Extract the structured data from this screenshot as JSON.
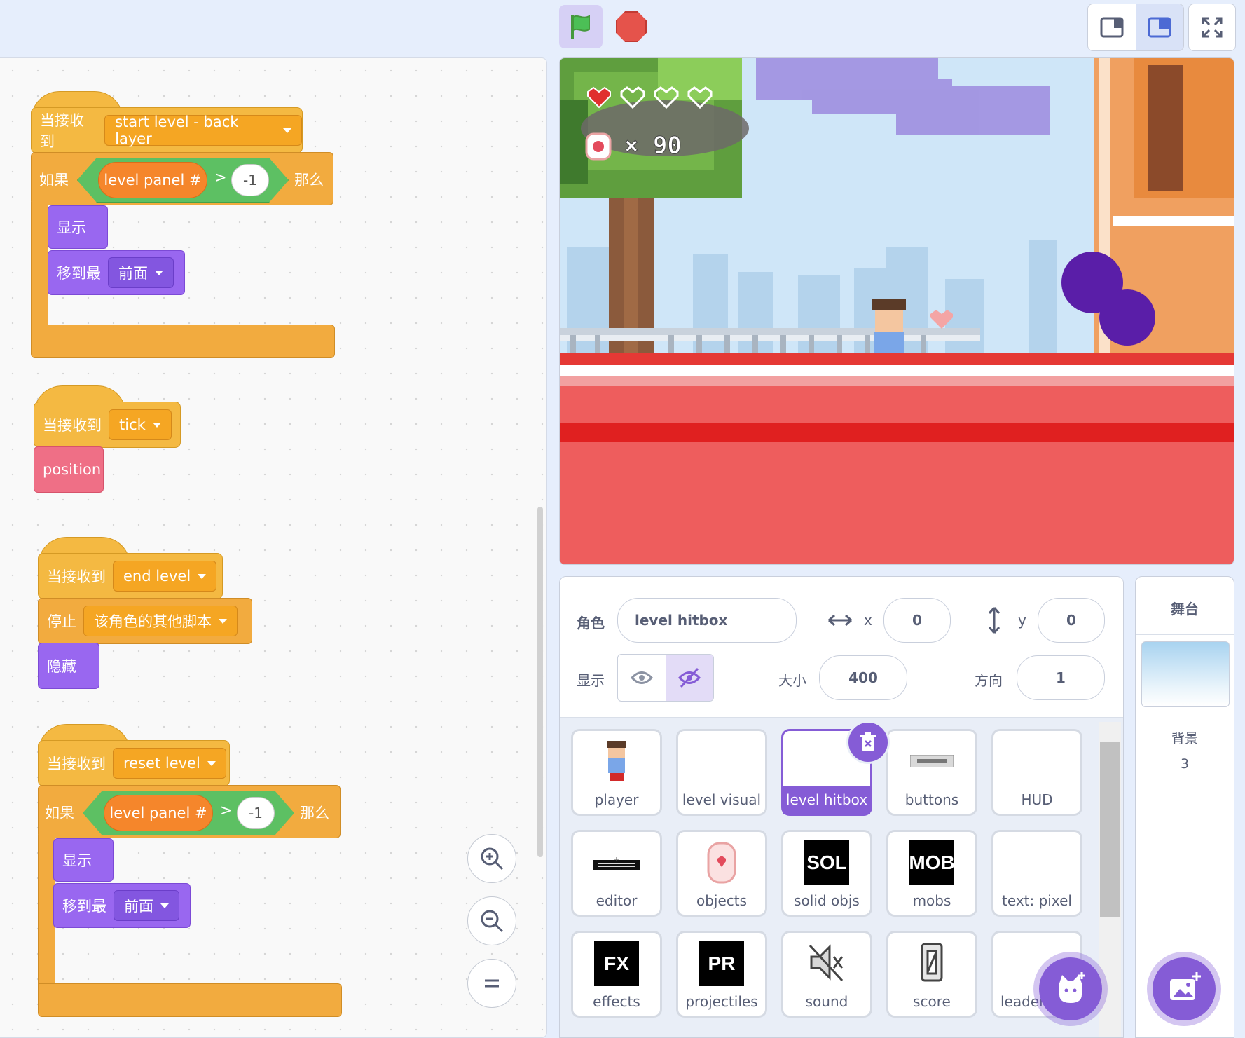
{
  "colors": {
    "events": "#f4b942",
    "control": "#f2ab3f",
    "looks": "#9967f0",
    "operators": "#5dc063",
    "variables": "#f5862b",
    "my_blocks": "#ef6f86",
    "accent": "#855cd6"
  },
  "scripts": [
    {
      "hat": {
        "label": "当接收到",
        "message": "start level - back layer"
      },
      "if": {
        "label": "如果",
        "then": "那么",
        "reporter": "level panel #",
        "op": ">",
        "value": "-1"
      },
      "inner": [
        {
          "label": "显示"
        },
        {
          "label": "移到最",
          "option": "前面"
        }
      ]
    },
    {
      "hat": {
        "label": "当接收到",
        "message": "tick"
      },
      "call": "position"
    },
    {
      "hat": {
        "label": "当接收到",
        "message": "end level"
      },
      "stop": {
        "label": "停止",
        "option": "该角色的其他脚本"
      },
      "hide": "隐藏"
    },
    {
      "hat": {
        "label": "当接收到",
        "message": "reset level"
      },
      "if": {
        "label": "如果",
        "then": "那么",
        "reporter": "level panel #",
        "op": ">",
        "value": "-1"
      },
      "inner": [
        {
          "label": "显示"
        },
        {
          "label": "移到最",
          "option": "前面"
        }
      ]
    }
  ],
  "zoom": {
    "in_icon": "zoom-in-icon",
    "out_icon": "zoom-out-icon",
    "reset_icon": "zoom-reset-icon"
  },
  "stage_hud": {
    "coins_text": "× 90",
    "hearts_full": 1,
    "hearts_total": 4
  },
  "sprite_info": {
    "sprite_label": "角色",
    "sprite_name": "level hitbox",
    "x_label": "x",
    "x_value": "0",
    "y_label": "y",
    "y_value": "0",
    "show_label": "显示",
    "size_label": "大小",
    "size_value": "400",
    "direction_label": "方向",
    "direction_value": "1"
  },
  "sprites": [
    {
      "name": "player",
      "thumb": "player-figure"
    },
    {
      "name": "level visual",
      "thumb": "blank"
    },
    {
      "name": "level hitbox",
      "thumb": "blank",
      "selected": true
    },
    {
      "name": "buttons",
      "thumb": "back-button"
    },
    {
      "name": "HUD",
      "thumb": "blank"
    },
    {
      "name": "editor",
      "thumb": "editor-banner"
    },
    {
      "name": "objects",
      "thumb": "heart-coin"
    },
    {
      "name": "solid objs",
      "thumb": "SOL"
    },
    {
      "name": "mobs",
      "thumb": "MOB"
    },
    {
      "name": "text: pixel",
      "thumb": "blank"
    },
    {
      "name": "effects",
      "thumb": "FX"
    },
    {
      "name": "projectiles",
      "thumb": "PR"
    },
    {
      "name": "sound",
      "thumb": "speaker-muted"
    },
    {
      "name": "score",
      "thumb": "zero-digit"
    },
    {
      "name": "leaderboard",
      "thumb": "blank"
    }
  ],
  "stage_panel": {
    "title": "舞台",
    "backdrop_label": "背景",
    "backdrop_count": "3"
  }
}
